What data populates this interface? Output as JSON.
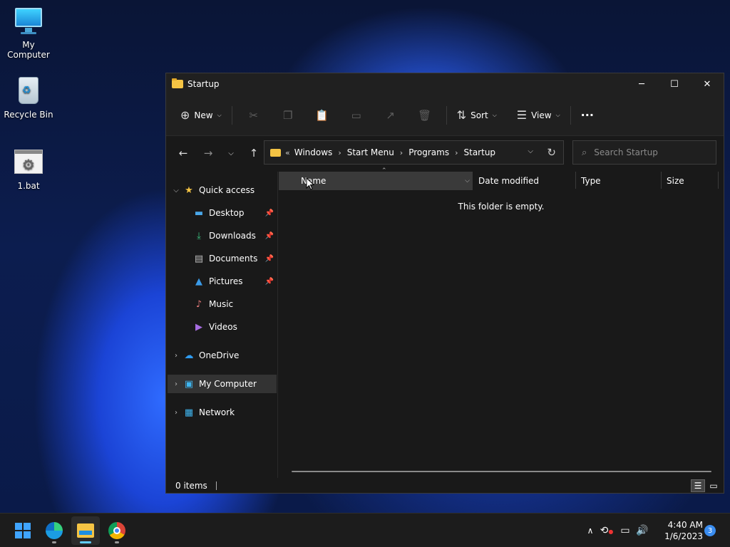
{
  "desktop": {
    "icons": [
      {
        "label": "My Computer",
        "icon": "monitor-icon"
      },
      {
        "label": "Recycle Bin",
        "icon": "recycle-bin-icon"
      },
      {
        "label": "1.bat",
        "icon": "batch-file-icon"
      }
    ]
  },
  "window": {
    "title": "Startup",
    "controls": {
      "minimize": "─",
      "maximize": "☐",
      "close": "✕"
    },
    "toolbar": {
      "new_label": "New",
      "sort_label": "Sort",
      "view_label": "View",
      "more_label": "···"
    },
    "address": {
      "prefix": "«",
      "crumbs": [
        "Windows",
        "Start Menu",
        "Programs",
        "Startup"
      ]
    },
    "search": {
      "placeholder": "Search Startup"
    },
    "sidebar": {
      "quick_access": "Quick access",
      "items": [
        {
          "label": "Desktop",
          "pinned": true
        },
        {
          "label": "Downloads",
          "pinned": true
        },
        {
          "label": "Documents",
          "pinned": true
        },
        {
          "label": "Pictures",
          "pinned": true
        },
        {
          "label": "Music",
          "pinned": false
        },
        {
          "label": "Videos",
          "pinned": false
        }
      ],
      "onedrive": "OneDrive",
      "my_computer": "My Computer",
      "network": "Network"
    },
    "columns": [
      "Name",
      "Date modified",
      "Type",
      "Size"
    ],
    "empty_message": "This folder is empty.",
    "status": {
      "items": "0 items"
    }
  },
  "taskbar": {
    "apps": [
      "start",
      "edge",
      "file-explorer",
      "chrome"
    ],
    "clock": {
      "time": "4:40 AM",
      "date": "1/6/2023"
    },
    "notification_count": "3"
  },
  "colors": {
    "accent": "#60cdff",
    "folder": "#f5c444",
    "window_bg": "#191919"
  }
}
